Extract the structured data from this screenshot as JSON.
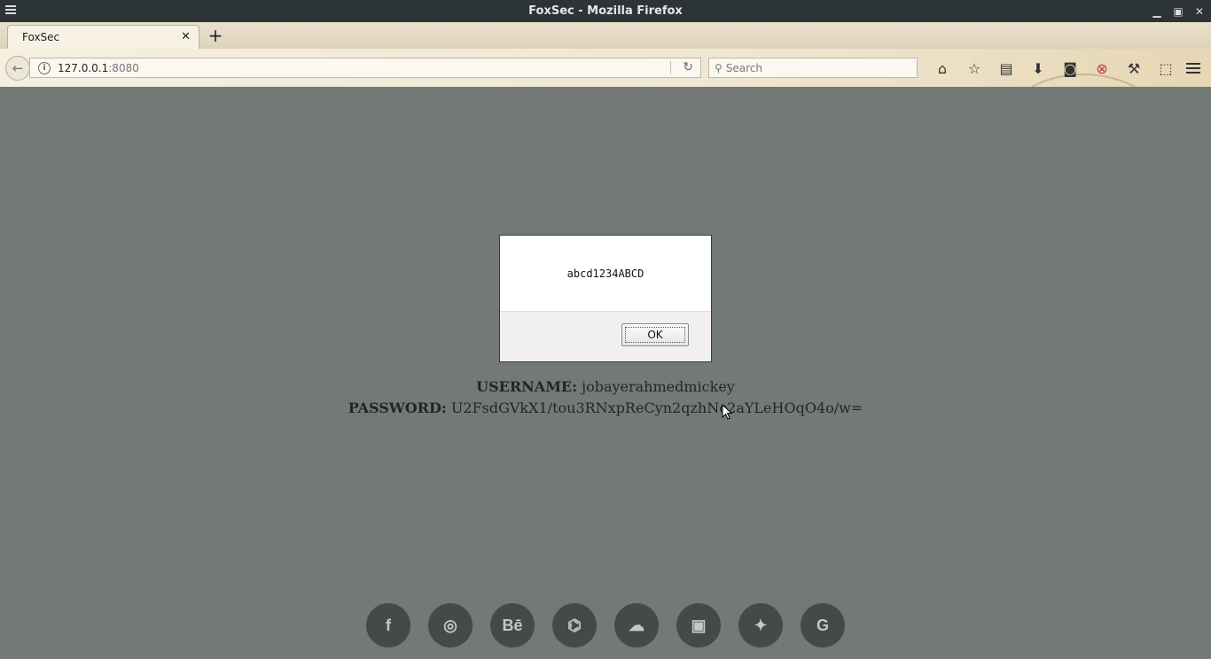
{
  "window": {
    "title": "FoxSec - Mozilla Firefox"
  },
  "tab": {
    "title": "FoxSec"
  },
  "navbar": {
    "url_host": "127.0.0.1",
    "url_port": ":8080",
    "search_placeholder": "Search"
  },
  "dialog": {
    "message": "abcd1234ABCD",
    "ok_label": "OK"
  },
  "credentials": {
    "username_label": "USERNAME:",
    "username_value": "jobayerahmedmickey",
    "password_label": "PASSWORD:",
    "password_value": "U2FsdGVkX1/tou3RNxpReCyn2qzhNc2aYLeHOqO4o/w="
  },
  "social": [
    {
      "icon": "facebook-icon",
      "glyph": "f"
    },
    {
      "icon": "dribbble-icon",
      "glyph": "◎"
    },
    {
      "icon": "behance-icon",
      "glyph": "Bē"
    },
    {
      "icon": "github-icon",
      "glyph": "⌬"
    },
    {
      "icon": "cloud-icon",
      "glyph": "☁"
    },
    {
      "icon": "briefcase-icon",
      "glyph": "▣"
    },
    {
      "icon": "twitter-icon",
      "glyph": "✦"
    },
    {
      "icon": "google-icon",
      "glyph": "G"
    }
  ]
}
